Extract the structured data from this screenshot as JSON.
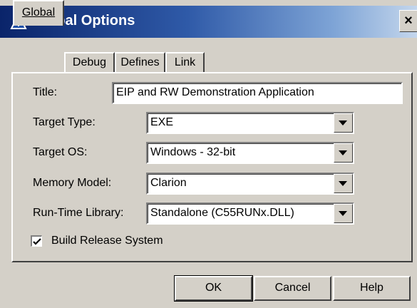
{
  "window": {
    "title": "Global Options",
    "close_glyph": "×"
  },
  "tabs": [
    "Global",
    "Debug",
    "Defines",
    "Link"
  ],
  "form": {
    "title_label": "Title:",
    "title_value": "EIP and RW Demonstration Application",
    "target_type_label": "Target Type:",
    "target_type_value": "EXE",
    "target_os_label": "Target OS:",
    "target_os_value": "Windows - 32-bit",
    "memory_model_label": "Memory Model:",
    "memory_model_value": "Clarion",
    "runtime_label": "Run-Time Library:",
    "runtime_value": "Standalone (C55RUNx.DLL)",
    "build_release_label": "Build Release System",
    "build_release_checked": true
  },
  "buttons": {
    "ok": "OK",
    "cancel": "Cancel",
    "help": "Help"
  },
  "icons": {
    "app": "clarion-app-icon",
    "dropdown": "chevron-down-icon",
    "check": "checkmark-icon"
  }
}
